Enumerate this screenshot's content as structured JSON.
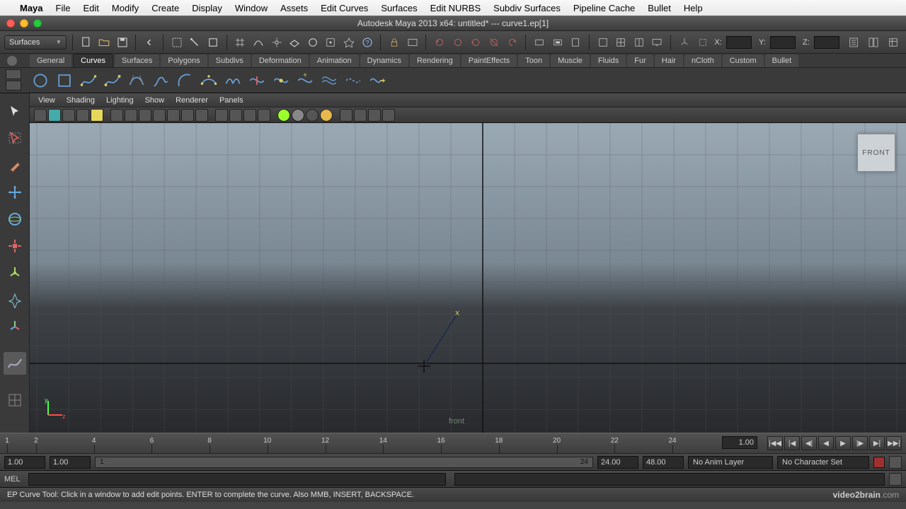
{
  "mac_menu": {
    "app": "Maya",
    "items": [
      "File",
      "Edit",
      "Modify",
      "Create",
      "Display",
      "Window",
      "Assets",
      "Edit Curves",
      "Surfaces",
      "Edit NURBS",
      "Subdiv Surfaces",
      "Pipeline Cache",
      "Bullet",
      "Help"
    ]
  },
  "titlebar": {
    "title": "Autodesk Maya 2013 x64: untitled*  ---  curve1.ep[1]"
  },
  "mode_select": {
    "label": "Surfaces"
  },
  "coords": {
    "x": "X:",
    "y": "Y:",
    "z": "Z:"
  },
  "shelf_tabs": [
    "General",
    "Curves",
    "Surfaces",
    "Polygons",
    "Subdivs",
    "Deformation",
    "Animation",
    "Dynamics",
    "Rendering",
    "PaintEffects",
    "Toon",
    "Muscle",
    "Fluids",
    "Fur",
    "Hair",
    "nCloth",
    "Custom",
    "Bullet"
  ],
  "active_shelf_tab": "Curves",
  "panel_menu": [
    "View",
    "Shading",
    "Lighting",
    "Show",
    "Renderer",
    "Panels"
  ],
  "viewcube": {
    "face": "FRONT"
  },
  "viewport_label": "front",
  "axis": {
    "y": "y",
    "z": "z"
  },
  "timeline": {
    "ticks": [
      1,
      2,
      4,
      6,
      8,
      10,
      12,
      14,
      16,
      18,
      20,
      22,
      24
    ],
    "current_frame": "1.00"
  },
  "range": {
    "start_out": "1.00",
    "start_in": "1.00",
    "end_in": "24.00",
    "end_out": "48.00",
    "slider_start": "1",
    "slider_end": "24",
    "anim_layer": "No Anim Layer",
    "char_set": "No Character Set"
  },
  "cmd": {
    "label": "MEL"
  },
  "help": {
    "text": "EP Curve Tool: Click in a window to add edit points. ENTER to complete the curve. Also MMB, INSERT, BACKSPACE."
  },
  "watermark": {
    "brand": "video2brain",
    "tld": ".com"
  }
}
